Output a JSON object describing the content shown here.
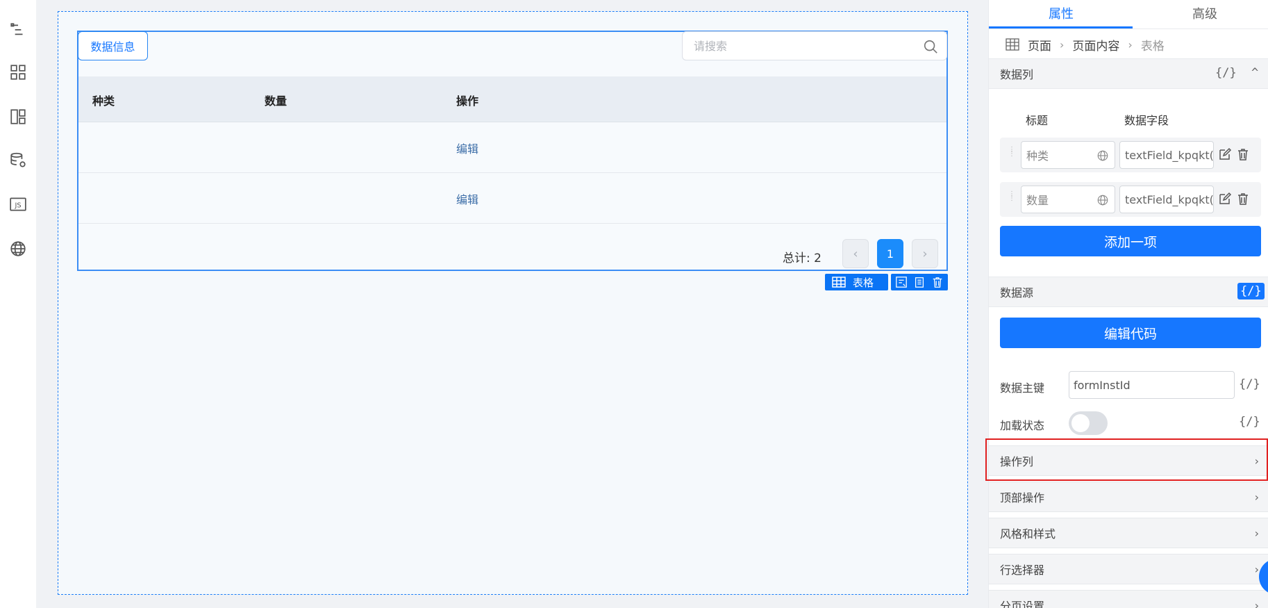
{
  "rail": {
    "items": [
      {
        "name": "outline-icon"
      },
      {
        "name": "components-icon"
      },
      {
        "name": "layout-icon"
      },
      {
        "name": "datasource-icon"
      },
      {
        "name": "js-icon",
        "text": "JS"
      },
      {
        "name": "globe-icon"
      }
    ]
  },
  "canvas": {
    "tag_button": "数据信息",
    "search_placeholder": "请搜索",
    "table": {
      "headers": [
        "种类",
        "数量",
        "操作"
      ],
      "rows": [
        {
          "kind": "",
          "qty": "",
          "action": "编辑"
        },
        {
          "kind": "",
          "qty": "",
          "action": "编辑"
        }
      ]
    },
    "pagination": {
      "total": "总计: 2",
      "current_page": "1",
      "prev": "‹",
      "next": "›"
    },
    "component_label": "表格"
  },
  "panel": {
    "tabs": [
      "属性",
      "高级"
    ],
    "breadcrumb": [
      "页面",
      "页面内容",
      "表格"
    ],
    "data_columns": {
      "title": "数据列",
      "code_tag": "{/}",
      "collapse_icon": "^",
      "col_title_header": "标题",
      "col_field_header": "数据字段",
      "rows": [
        {
          "title": "种类",
          "field": "textField_kpqkt("
        },
        {
          "title": "数量",
          "field": "textField_kpqkt("
        }
      ],
      "add_button": "添加一项"
    },
    "datasource": {
      "title": "数据源",
      "code_tag": "{/}",
      "edit_code_button": "编辑代码",
      "primary_key_label": "数据主键",
      "primary_key_value": "formInstId",
      "primary_key_code": "{/}",
      "loading_label": "加载状态",
      "loading_code": "{/}",
      "loading_on": false
    },
    "collapsibles": [
      "操作列",
      "顶部操作",
      "风格和样式",
      "行选择器",
      "分页设置"
    ],
    "chevron": "›"
  },
  "colors": {
    "primary": "#1677ff",
    "highlight": "#e02020"
  }
}
